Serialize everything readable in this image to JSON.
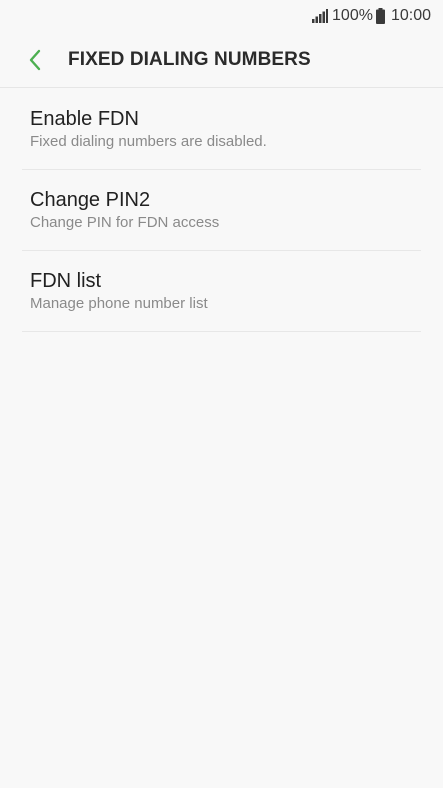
{
  "status_bar": {
    "battery_level": "100%",
    "time": "10:00",
    "icons": [
      "signal-icon",
      "battery-icon"
    ]
  },
  "header": {
    "title": "FIXED DIALING NUMBERS",
    "back_icon": "chevron-left-icon",
    "accent_color": "#4caf50"
  },
  "items": [
    {
      "label": "Enable FDN",
      "description": "Fixed dialing numbers are disabled."
    },
    {
      "label": "Change PIN2",
      "description": "Change PIN for FDN access"
    },
    {
      "label": "FDN list",
      "description": "Manage phone number list"
    }
  ]
}
